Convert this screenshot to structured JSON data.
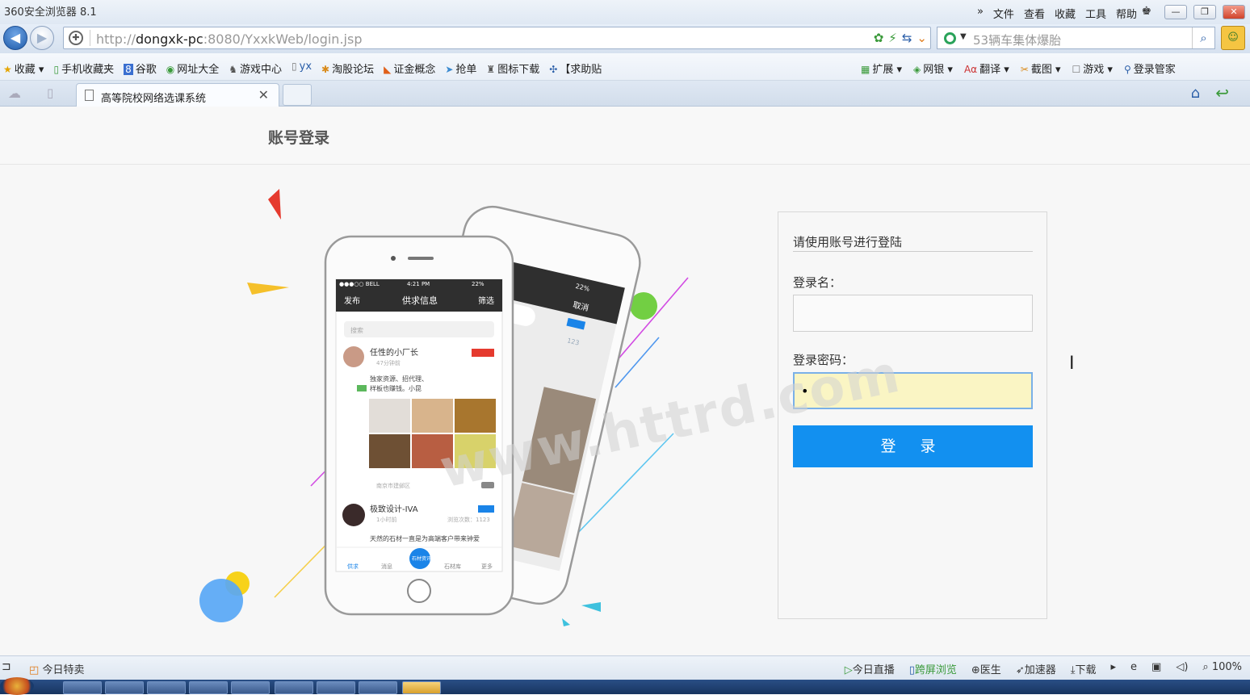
{
  "window": {
    "title": "360安全浏览器 8.1",
    "menus": [
      "»",
      "文件",
      "查看",
      "收藏",
      "工具",
      "帮助"
    ]
  },
  "navbar": {
    "url_prefix": "http://",
    "url_host": "dongxk-pc",
    "url_rest": ":8080/YxxkWeb/login.jsp",
    "search_text": "53辆车集体爆胎"
  },
  "favorites": {
    "left": [
      "收藏",
      "手机收藏夹",
      "谷歌",
      "网址大全",
      "游戏中心",
      "yx",
      "淘股论坛",
      "证金概念",
      "抢单",
      "图标下载",
      "【求助贴"
    ],
    "right": [
      "扩展",
      "网银",
      "翻译",
      "截图",
      "游戏",
      "登录管家"
    ]
  },
  "tab": {
    "label": "高等院校网络选课系统",
    "close": "✕"
  },
  "page": {
    "header_title": "账号登录",
    "login": {
      "subtitle": "请使用账号进行登陆",
      "username_label": "登录名：",
      "username_value": "",
      "password_label": "登录密码：",
      "password_value": "•",
      "submit_label": "登 录"
    },
    "phone_front": {
      "status_left": "●●●○○ BELL",
      "status_time": "4:21 PM",
      "status_right": "22%",
      "nav_left": "发布",
      "nav_title": "供求信息",
      "nav_right": "筛选",
      "search_placeholder": "搜索",
      "post1_name": "任性的小厂长",
      "post1_time": "47分钟前",
      "post1_text_1": "独家资源、招代理、",
      "post1_text_2": "样板也赚钱。小昆",
      "post1_location": "南京市建邺区",
      "post2_name": "极致设计-IVA",
      "post2_time": "1小时前",
      "post2_views": "浏览次数：1123",
      "post2_text": "天然的石材一直是为高端客户带来钟爱",
      "tabs": [
        "供求",
        "消息",
        "石材库",
        "更多"
      ],
      "center_tab": "石材资讯"
    },
    "phone_back": {
      "cancel": "取消",
      "battery": "22%",
      "count": "123"
    },
    "watermark": "www.httrd.com"
  },
  "statusbar": {
    "left": "今日特卖",
    "right": [
      "今日直播",
      "跨屏浏览",
      "医生",
      "加速器",
      "下载",
      "100%"
    ]
  }
}
